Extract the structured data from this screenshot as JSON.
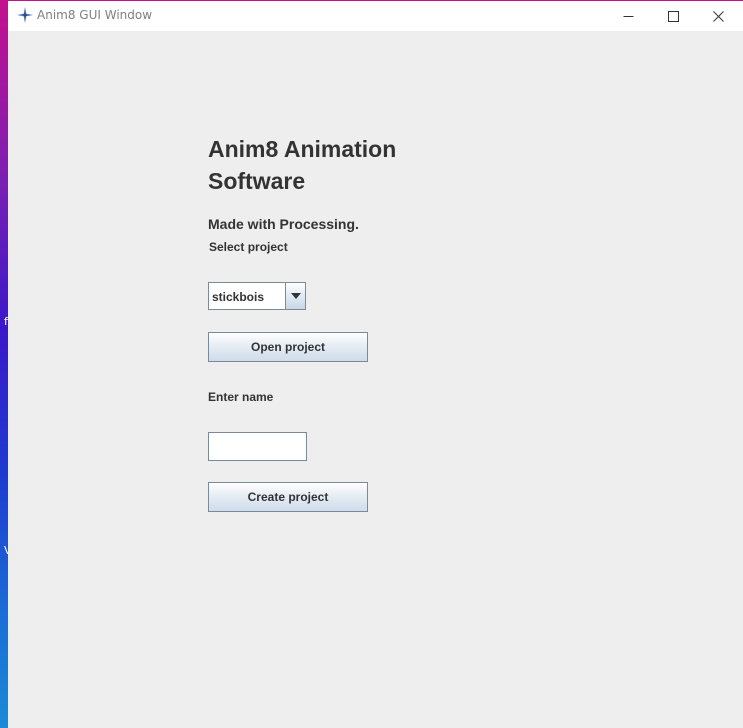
{
  "window": {
    "title": "Anim8 GUI Window",
    "icon": "java-app-icon",
    "controls": [
      "minimize-icon",
      "maximize-icon",
      "close-icon"
    ]
  },
  "desktop": {
    "glyph_1": "f",
    "glyph_2": "V"
  },
  "main": {
    "heading_line1": "Anim8 Animation",
    "heading_line2": "Software",
    "subtitle": "Made with Processing.",
    "select_label": "Select project",
    "project_dropdown": {
      "selected": "stickbois"
    },
    "open_button": "Open project",
    "name_label": "Enter name",
    "name_input": {
      "value": "",
      "placeholder": ""
    },
    "create_button": "Create project"
  },
  "colors": {
    "window_background": "#eeeeee",
    "text": "#333333",
    "border": "#7a8a99"
  }
}
